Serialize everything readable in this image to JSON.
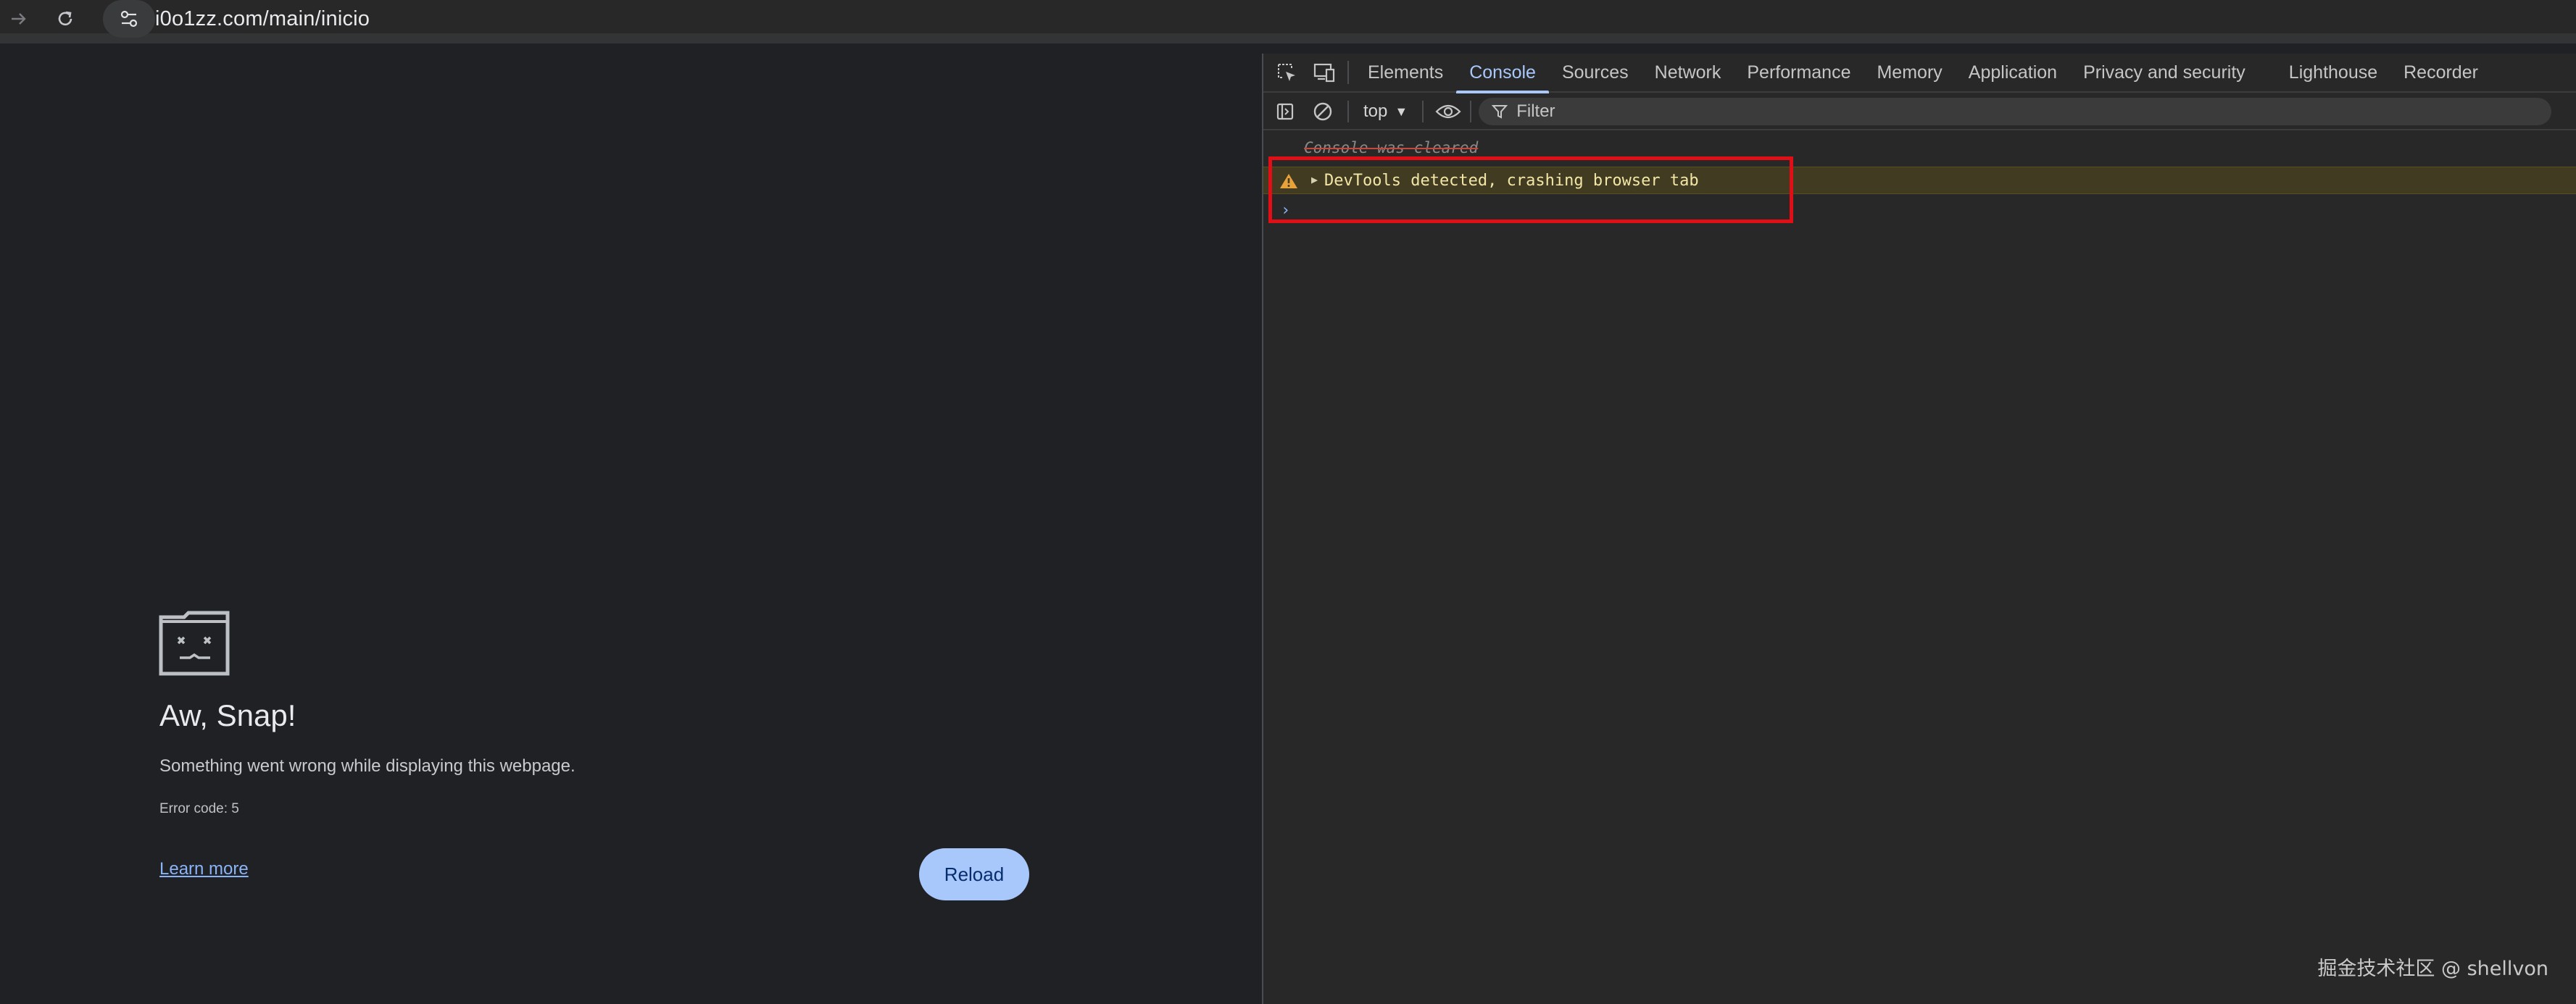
{
  "browser": {
    "url": "i0o1zz.com/main/inicio"
  },
  "crash_page": {
    "title": "Aw, Snap!",
    "message": "Something went wrong while displaying this webpage.",
    "error_code": "Error code: 5",
    "learn_more": "Learn more",
    "reload": "Reload"
  },
  "devtools": {
    "tabs": [
      {
        "label": "Elements",
        "active": false
      },
      {
        "label": "Console",
        "active": true
      },
      {
        "label": "Sources",
        "active": false
      },
      {
        "label": "Network",
        "active": false
      },
      {
        "label": "Performance",
        "active": false
      },
      {
        "label": "Memory",
        "active": false
      },
      {
        "label": "Application",
        "active": false
      },
      {
        "label": "Privacy and security",
        "active": false
      },
      {
        "label": "Lighthouse",
        "active": false
      },
      {
        "label": "Recorder",
        "active": false
      }
    ],
    "toolbar": {
      "context": "top",
      "filter_placeholder": "Filter"
    },
    "console": {
      "cleared": "Console was cleared",
      "warning": "DevTools detected, crashing browser tab",
      "prompt": "›"
    }
  },
  "colors": {
    "accent": "#a8c7fa",
    "warning_bg": "#413b22",
    "highlight": "#e10e16"
  },
  "watermark": "掘金技术社区 @ shellvon"
}
